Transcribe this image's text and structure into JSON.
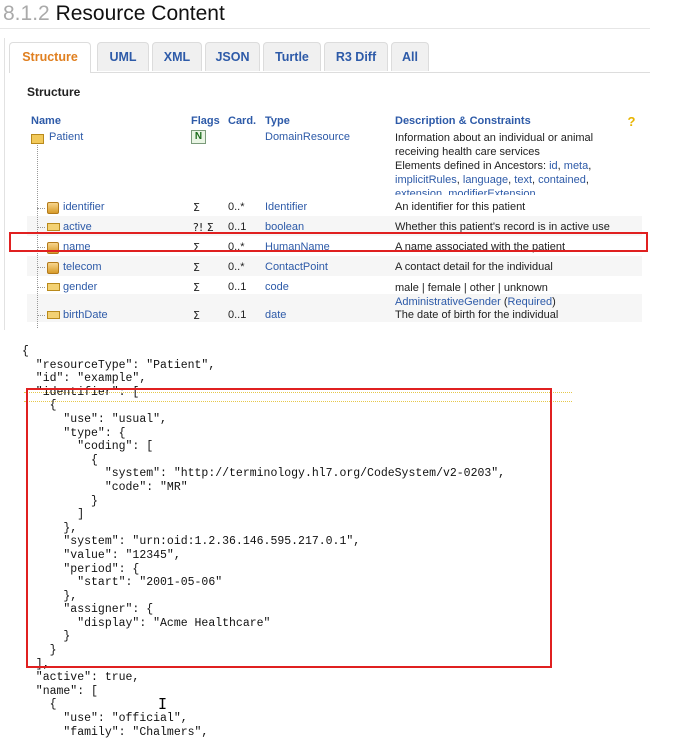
{
  "section": {
    "number": "8.1.2",
    "title": "Resource Content"
  },
  "tabs": [
    "Structure",
    "UML",
    "XML",
    "JSON",
    "Turtle",
    "R3 Diff",
    "All"
  ],
  "structure_title": "Structure",
  "table": {
    "headers": {
      "name": "Name",
      "flags": "Flags",
      "card": "Card.",
      "type": "Type",
      "desc": "Description & Constraints"
    },
    "root": {
      "name": "Patient",
      "flag": "N",
      "type": "DomainResource",
      "desc_line1": "Information about an individual or animal",
      "desc_line2": "receiving health care services",
      "ancestors_prefix": "Elements defined in Ancestors: ",
      "ancestors": [
        "id",
        "meta",
        "implicitRules",
        "language",
        "text",
        "contained",
        "extension",
        "modifierExtension"
      ]
    },
    "rows": [
      {
        "name": "identifier",
        "flags": "Σ",
        "card": "0..*",
        "type": "Identifier",
        "desc": "An identifier for this patient"
      },
      {
        "name": "active",
        "flags": "?! Σ",
        "card": "0..1",
        "type": "boolean",
        "desc": "Whether this patient's record is in active use"
      },
      {
        "name": "name",
        "flags": "Σ",
        "card": "0..*",
        "type": "HumanName",
        "desc": "A name associated with the patient"
      },
      {
        "name": "telecom",
        "flags": "Σ",
        "card": "0..*",
        "type": "ContactPoint",
        "desc": "A contact detail for the individual"
      },
      {
        "name": "gender",
        "flags": "Σ",
        "card": "0..1",
        "type": "code",
        "desc": "male | female | other | unknown",
        "binding": "AdministrativeGender",
        "strength": "Required"
      },
      {
        "name": "birthDate",
        "flags": "Σ",
        "card": "0..1",
        "type": "date",
        "desc": "The date of birth for the individual"
      }
    ]
  },
  "json_lines": [
    "{",
    "  \"resourceType\": \"Patient\",",
    "  \"id\": \"example\",",
    "  \"identifier\": [",
    "    {",
    "      \"use\": \"usual\",",
    "      \"type\": {",
    "        \"coding\": [",
    "          {",
    "            \"system\": \"http://terminology.hl7.org/CodeSystem/v2-0203\",",
    "            \"code\": \"MR\"",
    "          }",
    "        ]",
    "      },",
    "      \"system\": \"urn:oid:1.2.36.146.595.217.0.1\",",
    "      \"value\": \"12345\",",
    "      \"period\": {",
    "        \"start\": \"2001-05-06\"",
    "      },",
    "      \"assigner\": {",
    "        \"display\": \"Acme Healthcare\"",
    "      }",
    "    }",
    "  ],",
    "  \"active\": true,",
    "  \"name\": [",
    "    {",
    "      \"use\": \"official\",",
    "      \"family\": \"Chalmers\","
  ],
  "colors": {
    "link": "#2d5aa8",
    "active_tab": "#e07f1f",
    "highlight": "#e02020"
  }
}
